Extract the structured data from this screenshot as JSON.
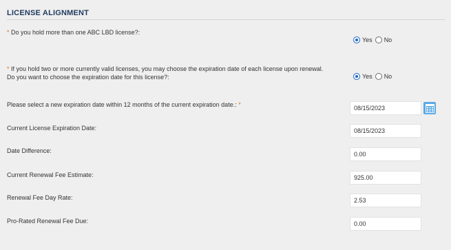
{
  "section": {
    "title": "LICENSE ALIGNMENT"
  },
  "questions": [
    {
      "required_mark": "*",
      "label": "Do you hold more than one ABC LBD license?:",
      "options": [
        {
          "label": "Yes",
          "checked": true
        },
        {
          "label": "No",
          "checked": false
        }
      ]
    },
    {
      "required_mark": "*",
      "label_line1": "If you hold two or more currently valid licenses, you may choose the expiration date of each license upon renewal.",
      "label_line2": "Do you want to choose the expiration date for this license?:",
      "options": [
        {
          "label": "Yes",
          "checked": true
        },
        {
          "label": "No",
          "checked": false
        }
      ]
    }
  ],
  "fields": {
    "new_expiration": {
      "label": "Please select a new expiration date within 12 months of the current expiration date.:",
      "required_mark": "*",
      "value": "08/15/2023",
      "calendar_icon": "calendar-icon"
    },
    "current_expiration": {
      "label": "Current License Expiration Date:",
      "value": "08/15/2023"
    },
    "date_difference": {
      "label": "Date Difference:",
      "value": "0.00"
    },
    "renewal_fee_estimate": {
      "label": "Current Renewal Fee Estimate:",
      "value": "925.00"
    },
    "fee_day_rate": {
      "label": "Renewal Fee Day Rate:",
      "value": "2.53"
    },
    "prorated_fee_due": {
      "label": "Pro-Rated Renewal Fee Due:",
      "value": "0.00"
    }
  },
  "colors": {
    "heading": "#1f3a5f",
    "required": "#d9751f",
    "radio_selected": "#1a62c4",
    "calendar_button": "#5aa9e6"
  }
}
